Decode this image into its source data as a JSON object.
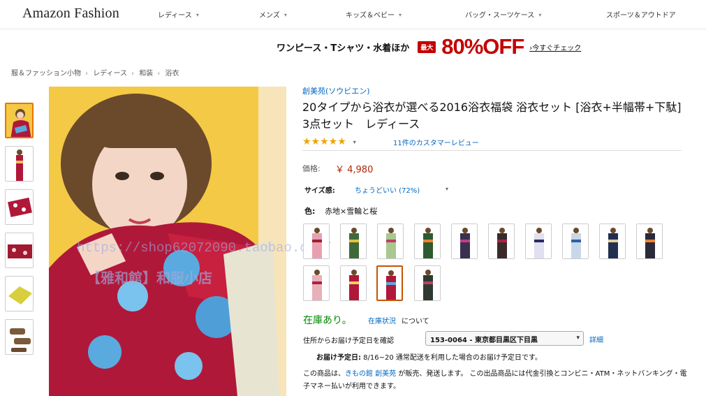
{
  "header": {
    "logo": "Amazon Fashion",
    "nav": [
      {
        "label": "レディース"
      },
      {
        "label": "メンズ"
      },
      {
        "label": "キッズ＆ベビー"
      },
      {
        "label": "バッグ・スーツケース"
      },
      {
        "label": "スポーツ＆アウトドア"
      }
    ]
  },
  "promo": {
    "text": "ワンピース・Tシャツ・水着ほか",
    "badge": "最大",
    "off": "80%OFF",
    "link": "今すぐチェック"
  },
  "breadcrumb": [
    "服＆ファッション小物",
    "レディース",
    "和装",
    "浴衣"
  ],
  "product": {
    "brand": "創美苑(ソウビエン)",
    "title": "20タイプから浴衣が選べる2016浴衣福袋 浴衣セット [浴衣+半幅帯+下駄] 3点セット　レディース",
    "rating": 4.5,
    "stars": "★★★★★",
    "reviews": "11件のカスタマーレビュー",
    "price_label": "価格:",
    "price": "￥ 4,980",
    "size_label": "サイズ感:",
    "size_value": "ちょうどいい (72%)",
    "color_label": "色:",
    "color_value": "赤地×雪輪と桜",
    "stock": "在庫あり。",
    "stock_link": "在庫状況",
    "stock_after": "について",
    "addr_label": "住所からお届け予定日を確認",
    "zip": "153-0064 - 東京都目黒区下目黒",
    "detail_link": "詳細",
    "delivery_bold": "お届け予定日:",
    "delivery_text": " 8/16~20 通常配送を利用した場合のお届け予定日です。",
    "note_pre": "この商品は、",
    "note_link": "きもの館 創美苑",
    "note_post": " が販売、発送します。 この出品商品には代金引換とコンビニ・ATM・ネットバンキング・電子マネー払いが利用できます。"
  },
  "watermark": {
    "line1": "https://shop62072090.taobao.com/",
    "line2": "【雅和館】和服小店"
  },
  "colors": {
    "link": "#0066c0",
    "price": "#b12704",
    "accent": "#e77600",
    "stock": "#008a00",
    "promo": "#c40000"
  },
  "icons": {
    "caret": "▾"
  }
}
